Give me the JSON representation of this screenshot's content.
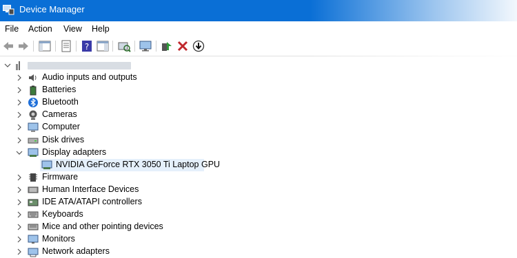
{
  "window": {
    "title": "Device Manager"
  },
  "menu": [
    "File",
    "Action",
    "View",
    "Help"
  ],
  "toolbar": {
    "buttons": [
      "back-icon",
      "forward-icon",
      "properties-pane-icon",
      "properties-icon",
      "help-icon",
      "console-tree-icon",
      "scan-hardware-icon",
      "monitor-icon",
      "update-driver-icon",
      "uninstall-icon",
      "disable-device-icon"
    ]
  },
  "tree": {
    "categories": [
      {
        "label": "Audio inputs and outputs",
        "icon": "speaker-icon",
        "expanded": false
      },
      {
        "label": "Batteries",
        "icon": "battery-icon",
        "expanded": false
      },
      {
        "label": "Bluetooth",
        "icon": "bluetooth-icon",
        "expanded": false
      },
      {
        "label": "Cameras",
        "icon": "camera-icon",
        "expanded": false
      },
      {
        "label": "Computer",
        "icon": "computer-icon",
        "expanded": false
      },
      {
        "label": "Disk drives",
        "icon": "disk-drive-icon",
        "expanded": false
      },
      {
        "label": "Display adapters",
        "icon": "display-adapter-icon",
        "expanded": true
      },
      {
        "label": "NVIDIA GeForce RTX 3050 Ti Laptop GPU",
        "icon": "display-adapter-icon",
        "child": true,
        "selected": true
      },
      {
        "label": "Firmware",
        "icon": "firmware-icon",
        "expanded": false
      },
      {
        "label": "Human Interface Devices",
        "icon": "hid-icon",
        "expanded": false
      },
      {
        "label": "IDE ATA/ATAPI controllers",
        "icon": "ide-controller-icon",
        "expanded": false
      },
      {
        "label": "Keyboards",
        "icon": "keyboard-icon",
        "expanded": false
      },
      {
        "label": "Mice and other pointing devices",
        "icon": "mouse-icon",
        "expanded": false
      },
      {
        "label": "Monitors",
        "icon": "monitor-icon",
        "expanded": false
      },
      {
        "label": "Network adapters",
        "icon": "network-adapter-icon",
        "expanded": false
      }
    ]
  },
  "colors": {
    "titlebar": "#0a6fd6",
    "selection": "#e5f0fb"
  }
}
